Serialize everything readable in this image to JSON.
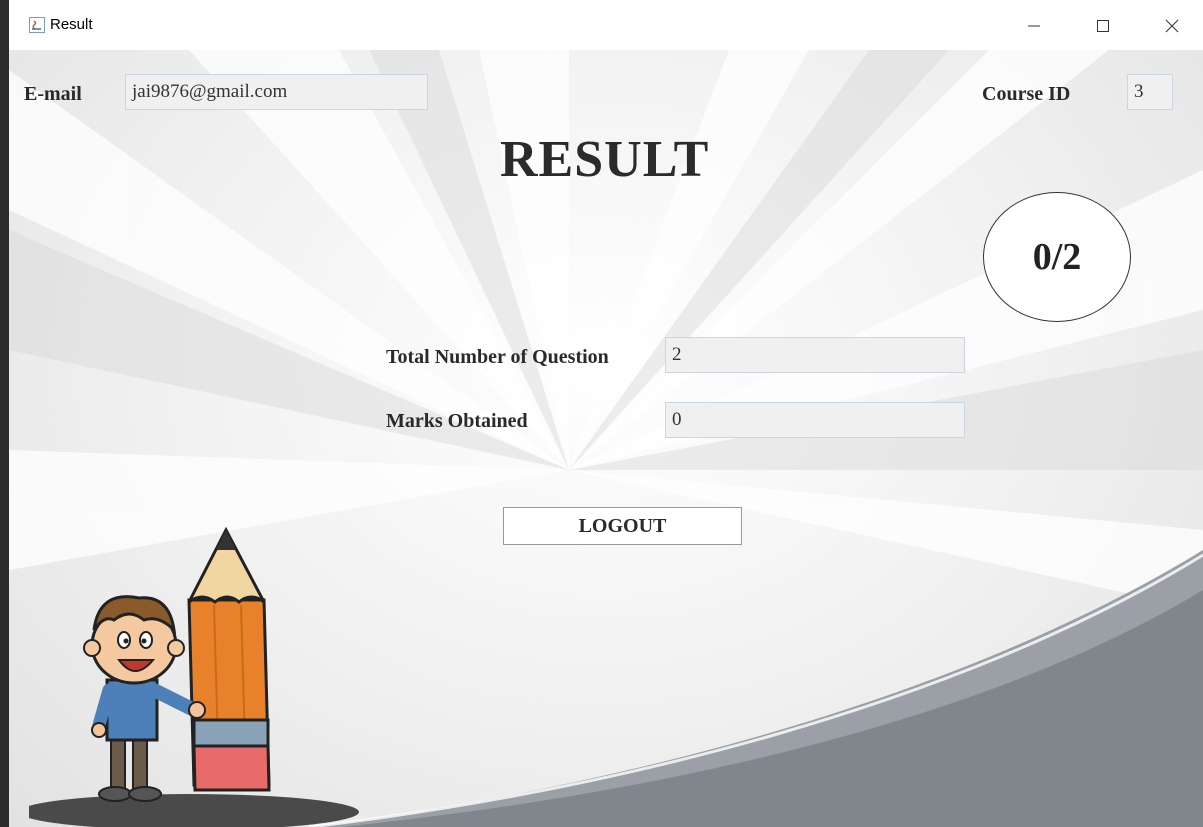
{
  "window": {
    "title": "Result",
    "controls": [
      "minimize-icon",
      "maximize-icon",
      "close-icon"
    ]
  },
  "header": {
    "email_label": "E-mail",
    "email_value": "jai9876@gmail.com",
    "course_label": "Course ID",
    "course_value": "3"
  },
  "main": {
    "title": "RESULT",
    "score": "0/2",
    "total_label": "Total Number of Question",
    "total_value": "2",
    "marks_label": "Marks Obtained",
    "marks_value": "0",
    "logout_label": "LOGOUT"
  },
  "colors": {
    "field_border": "#c9d6e6",
    "field_bg": "#f0f0f0",
    "wave": "#8a8f94",
    "text": "#2a2a2a"
  }
}
